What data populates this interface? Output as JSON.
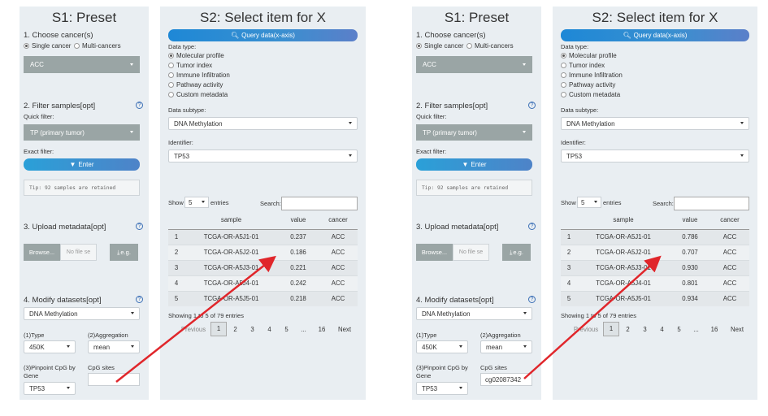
{
  "s1": {
    "title": "S1: Preset",
    "choose_cancer": "1. Choose cancer(s)",
    "radio_single": "Single cancer",
    "radio_multi": "Multi-cancers",
    "cancer_value": "ACC",
    "filter_samples": "2. Filter samples[opt]",
    "quick_filter_label": "Quick filter:",
    "quick_filter_value": "TP (primary tumor)",
    "exact_filter_label": "Exact filter:",
    "enter_label": "Enter",
    "tip": "Tip: 92 samples are retained",
    "upload_metadata": "3. Upload metadata[opt]",
    "browse_label": "Browse...",
    "no_file": "No file se",
    "eg_label": "e.g.",
    "modify_datasets": "4. Modify datasets[opt]",
    "dataset_value": "DNA Methylation",
    "type_label": "(1)Type",
    "type_value": "450K",
    "aggregation_label": "(2)Aggregation",
    "aggregation_value": "mean",
    "pinpoint_label_1": "(3)Pinpoint CpG by",
    "pinpoint_label_2": "Gene",
    "cpg_sites_label": "CpG sites",
    "gene_value": "TP53",
    "cpg_sites_value_left": "",
    "cpg_sites_value_right": "cg02087342"
  },
  "s2": {
    "title": "S2: Select item for X",
    "query_button": "Query data(x-axis)",
    "data_type_label": "Data type:",
    "data_types": [
      "Molecular profile",
      "Tumor index",
      "Immune Infiltration",
      "Pathway activity",
      "Custom metadata"
    ],
    "data_subtype_label": "Data subtype:",
    "data_subtype_value": "DNA Methylation",
    "identifier_label": "Identifier:",
    "identifier_value": "TP53",
    "show_label": "Show",
    "show_value": "5",
    "entries_label": "entries",
    "search_label": "Search:",
    "columns": [
      "sample",
      "value",
      "cancer"
    ],
    "info_text": "Showing 1 to 5 of 79 entries",
    "pager": {
      "previous": "Previous",
      "pages": [
        "1",
        "2",
        "3",
        "4",
        "5",
        "...",
        "16"
      ],
      "next": "Next"
    }
  },
  "tables": {
    "left": [
      [
        "1",
        "TCGA-OR-A5J1-01",
        "0.237",
        "ACC"
      ],
      [
        "2",
        "TCGA-OR-A5J2-01",
        "0.186",
        "ACC"
      ],
      [
        "3",
        "TCGA-OR-A5J3-01",
        "0.221",
        "ACC"
      ],
      [
        "4",
        "TCGA-OR-A5J4-01",
        "0.242",
        "ACC"
      ],
      [
        "5",
        "TCGA-OR-A5J5-01",
        "0.218",
        "ACC"
      ]
    ],
    "right": [
      [
        "1",
        "TCGA-OR-A5J1-01",
        "0.786",
        "ACC"
      ],
      [
        "2",
        "TCGA-OR-A5J2-01",
        "0.707",
        "ACC"
      ],
      [
        "3",
        "TCGA-OR-A5J3-01",
        "0.930",
        "ACC"
      ],
      [
        "4",
        "TCGA-OR-A5J4-01",
        "0.801",
        "ACC"
      ],
      [
        "5",
        "TCGA-OR-A5J5-01",
        "0.934",
        "ACC"
      ]
    ]
  },
  "colors": {
    "accent_blue": "#1e88d6",
    "grey_control": "#9aa5a5",
    "panel_bg": "#e9eef2",
    "arrow_red": "#e0262b"
  }
}
